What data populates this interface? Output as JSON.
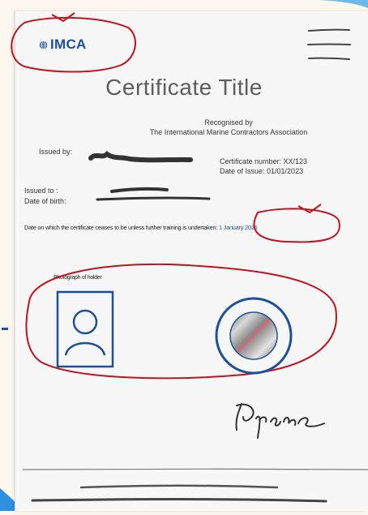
{
  "certificate": {
    "logo_text": "IMCA",
    "title": "Certificate Title",
    "recognised_by": "Recognised by",
    "association": "The International Marine Contractors Association",
    "issued_by_label": "Issued by:",
    "certificate_number": "Certificate number: XX/123",
    "date_of_issue": "Date of Issue: 01/01/2023",
    "issued_to_label": "Issued to :",
    "dob_label": "Date of birth:",
    "expiry_text": "Date on which the certificate ceases to be unless further training is undertaken:",
    "expiry_date": "1 January 2026",
    "photo_label": "Photograph of holder"
  },
  "icons": {
    "logo": "globe-icon",
    "menu": "hamburger-menu-icon",
    "photo": "person-portrait-icon",
    "seal": "hologram-seal-icon",
    "signature": "handwritten-signature-icon"
  },
  "colors": {
    "brand_blue": "#1e4f9c",
    "annotation_red": "#c1121f",
    "redaction_ink": "#333333",
    "card_background": "#f7f7f7",
    "page_background": "#fdf8ee"
  }
}
